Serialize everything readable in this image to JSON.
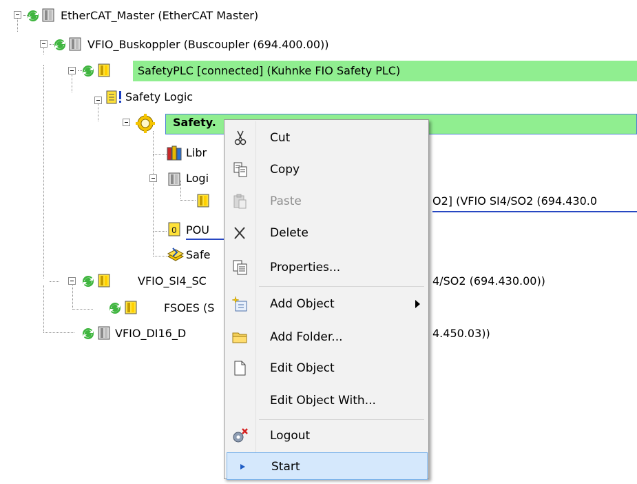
{
  "tree": {
    "nodes": [
      {
        "label": "EtherCAT_Master (EtherCAT Master)"
      },
      {
        "label": "VFIO_Buskoppler (Buscoupler (694.400.00))"
      },
      {
        "label": "SafetyPLC [connected] (Kuhnke FIO Safety PLC)"
      },
      {
        "label": "Safety Logic"
      },
      {
        "label": "Safety.",
        "hidden_suffix": "..."
      },
      {
        "label": "Libr"
      },
      {
        "label": "Logi"
      },
      {
        "label": "O2]  (VFIO SI4/SO2 (694.430.0"
      },
      {
        "label": "POU"
      },
      {
        "label": "Safe"
      },
      {
        "label": "VFIO_SI4_SC",
        "suffix": "4/SO2 (694.430.00))"
      },
      {
        "label": "FSOES (S"
      },
      {
        "label": "VFIO_DI16_D",
        "suffix": "4.450.03))"
      }
    ]
  },
  "menu": {
    "items": [
      {
        "label": "Cut",
        "icon": "scissors-icon"
      },
      {
        "label": "Copy",
        "icon": "copy-icon"
      },
      {
        "label": "Paste",
        "icon": "paste-icon",
        "disabled": true
      },
      {
        "label": "Delete",
        "icon": "delete-x-icon"
      },
      {
        "label": "Properties...",
        "icon": "properties-icon"
      },
      {
        "label": "Add Object",
        "icon": "add-object-icon",
        "submenu": true
      },
      {
        "label": "Add Folder...",
        "icon": "folder-icon"
      },
      {
        "label": "Edit Object",
        "icon": "edit-object-icon"
      },
      {
        "label": "Edit Object With...",
        "icon": ""
      },
      {
        "label": "Logout",
        "icon": "logout-gears-icon"
      },
      {
        "label": "Start",
        "icon": "play-arrow-icon",
        "highlighted": true
      }
    ]
  },
  "colors": {
    "highlight": "#90ee90",
    "menu_hover": "#d5e8fc",
    "link_underline": "#2747c2"
  }
}
